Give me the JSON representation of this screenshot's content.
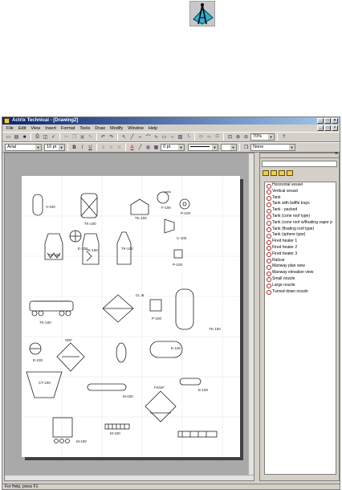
{
  "window": {
    "title": "Actrix Technical - [Drawing2]"
  },
  "menu": [
    "File",
    "Edit",
    "View",
    "Insert",
    "Format",
    "Tools",
    "Draw",
    "Modify",
    "Window",
    "Help"
  ],
  "format_bar": {
    "font": "Arial",
    "size": "10 pt",
    "line_weight": "0 pt",
    "fill": "None"
  },
  "toolbar": {
    "zoom": "70%"
  },
  "drawing_labels": {
    "v100": "V-100",
    "f100": "F-100",
    "tk100a": "TK-100",
    "tk100b": "TK-100",
    "p100a": "P-100",
    "e100a": "E-100",
    "c100": "C-100",
    "tk100c": "TK-100",
    "tk100d": "TK-100",
    "tk100e": "TK-100",
    "p100b": "P-100",
    "cl": "CL ⊕",
    "p100c": "P-100",
    "tk100f": "TK-100",
    "tk100g": "TK-100",
    "e100b": "E-100",
    "sdf": "SDF",
    "e100c": "E-100",
    "ct100": "CT-100",
    "m100a": "M-100",
    "fssf": "FS/SF",
    "e100d": "E-100",
    "m100b": "M-100",
    "m100c": "M-100"
  },
  "stencil_items": [
    "Horizontal vessel",
    "Vertical vessel",
    "Tank",
    "Tank with baffle trays",
    "Tank - packed",
    "Tank (cone roof type)",
    "Tank (cone roof w/floating vapor p",
    "Tank (floating roof type)",
    "Tank (sphere type)",
    "Fired heater 1",
    "Fired heater 2",
    "Fired heater 3",
    "Railcar",
    "Manway plan view",
    "Manway elevation view",
    "Small nozzle",
    "Large nozzle",
    "Turned down nozzle"
  ],
  "status": "For Help, press F1"
}
